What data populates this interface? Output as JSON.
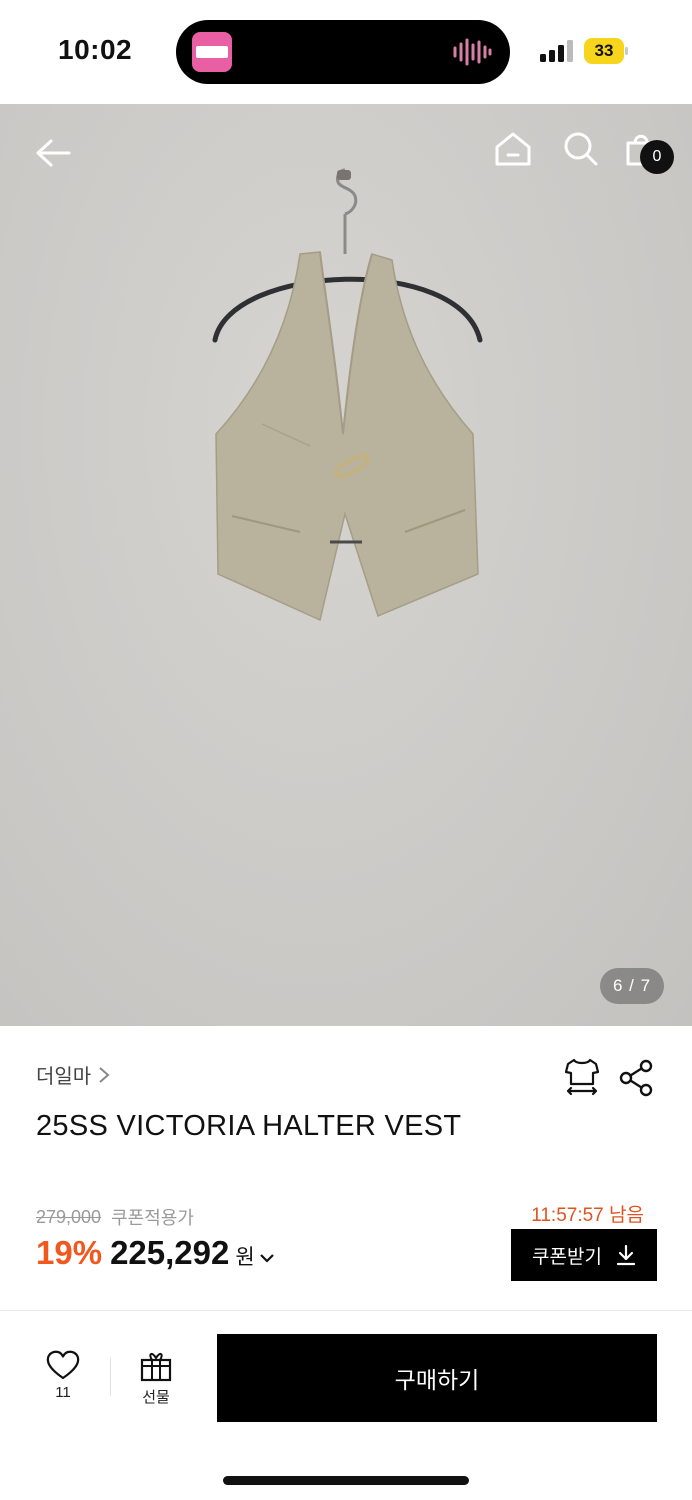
{
  "status_bar": {
    "time": "10:02",
    "battery": "33"
  },
  "header": {
    "cart_count": "0"
  },
  "gallery": {
    "pager": "6 / 7"
  },
  "product": {
    "brand": "더일마",
    "title": "25SS VICTORIA HALTER VEST",
    "original_price": "279,000",
    "coupon_price_label": "쿠폰적용가",
    "countdown": "11:57:57 남음",
    "discount": "19%",
    "price": "225,292",
    "currency": "원",
    "coupon_button": "쿠폰받기"
  },
  "bottom_bar": {
    "like_count": "11",
    "gift_label": "선물",
    "buy_label": "구매하기"
  },
  "colors": {
    "accent": "#f0581e",
    "countdown": "#e0531e",
    "primary": "#000000"
  },
  "icons": [
    "back-arrow-icon",
    "home-icon",
    "search-icon",
    "bag-icon",
    "chevron-right-icon",
    "size-fit-icon",
    "share-icon",
    "chevron-down-icon",
    "download-icon",
    "heart-icon",
    "gift-icon"
  ]
}
